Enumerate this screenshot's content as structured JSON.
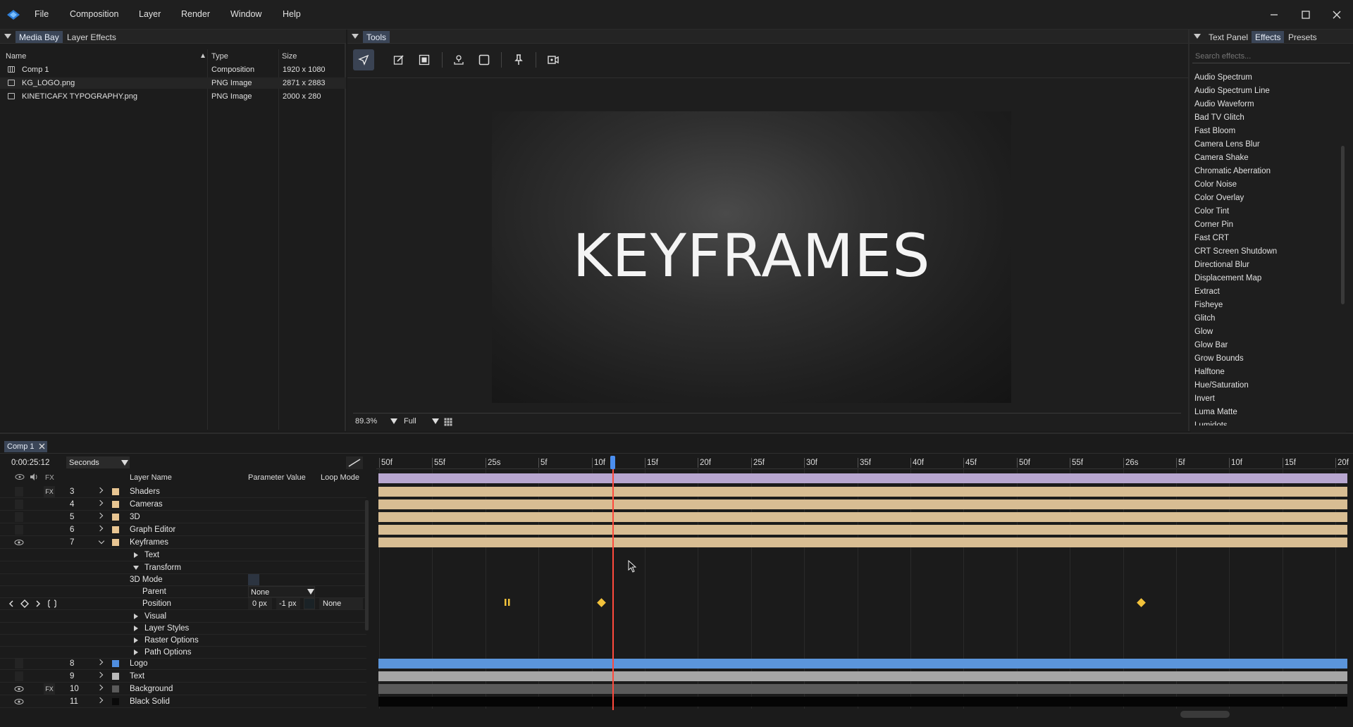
{
  "app": {
    "menu": [
      "File",
      "Composition",
      "Layer",
      "Render",
      "Window",
      "Help"
    ],
    "accent": "#3b6fd0",
    "window_controls": [
      "minimize-icon",
      "maximize-icon",
      "close-icon"
    ]
  },
  "media_bay": {
    "tabs": [
      "Media Bay",
      "Layer Effects"
    ],
    "columns": [
      "Name",
      "Type",
      "Size"
    ],
    "rows": [
      {
        "name": "Comp 1",
        "type": "Composition",
        "size": "1920 x 1080",
        "icon": "composition-icon"
      },
      {
        "name": "KG_LOGO.png",
        "type": "PNG Image",
        "size": "2871 x 2883",
        "icon": "image-icon"
      },
      {
        "name": "KINETICAFX TYPOGRAPHY.png",
        "type": "PNG Image",
        "size": "2000 x 280",
        "icon": "image-icon"
      }
    ]
  },
  "tools": {
    "tab": "Tools",
    "buttons": [
      "select-tool-icon",
      "edit-tool-icon",
      "mask-tool-icon",
      "anchor-tool-icon",
      "rectangle-tool-icon",
      "pin-tool-icon",
      "camera-tool-icon"
    ]
  },
  "viewer": {
    "canvas_text": "KEYFRAMES",
    "zoom": "89.3%",
    "quality": "Full"
  },
  "effects_panel": {
    "tabs": [
      "Text Panel",
      "Effects",
      "Presets"
    ],
    "search_placeholder": "Search effects...",
    "items": [
      "Audio Spectrum",
      "Audio Spectrum Line",
      "Audio Waveform",
      "Bad TV Glitch",
      "Fast Bloom",
      "Camera Lens Blur",
      "Camera Shake",
      "Chromatic Aberration",
      "Color Noise",
      "Color Overlay",
      "Color Tint",
      "Corner Pin",
      "Fast CRT",
      "CRT Screen Shutdown",
      "Directional Blur",
      "Displacement Map",
      "Extract",
      "Fisheye",
      "Glitch",
      "Glow",
      "Glow Bar",
      "Grow Bounds",
      "Halftone",
      "Hue/Saturation",
      "Invert",
      "Luma Matte",
      "Lumidots"
    ]
  },
  "timeline": {
    "comp_tab": "Comp 1",
    "timecode": "0:00:25:12",
    "time_unit": "Seconds",
    "fx_label": "FX",
    "columns": [
      "Layer Name",
      "Parameter Value",
      "Loop Mode"
    ],
    "ruler": [
      "50f",
      "55f",
      "25s",
      "5f",
      "10f",
      "15f",
      "20f",
      "25f",
      "30f",
      "35f",
      "40f",
      "45f",
      "50f",
      "55f",
      "26s",
      "5f",
      "10f",
      "15f",
      "20f"
    ],
    "layers_top": [
      {
        "num": "3",
        "name": "Shaders",
        "color": "#e8c592",
        "fx": "FX",
        "eye": false
      },
      {
        "num": "4",
        "name": "Cameras",
        "color": "#e8c592",
        "fx": "",
        "eye": false
      },
      {
        "num": "5",
        "name": "3D",
        "color": "#e8c592",
        "fx": "",
        "eye": false
      },
      {
        "num": "6",
        "name": "Graph Editor",
        "color": "#e8c592",
        "fx": "",
        "eye": false
      },
      {
        "num": "7",
        "name": "Keyframes",
        "color": "#e8c592",
        "fx": "",
        "eye": true
      }
    ],
    "props": {
      "text": "Text",
      "transform": "Transform",
      "mode3d": "3D Mode",
      "parent": "Parent",
      "parent_value": "None",
      "position": "Position",
      "pos_x": "0 px",
      "pos_y": "-1 px",
      "loop_mode": "None",
      "visual": "Visual",
      "layer_styles": "Layer Styles",
      "raster_options": "Raster Options",
      "path_options": "Path Options"
    },
    "layers_bottom": [
      {
        "num": "8",
        "name": "Logo",
        "color": "#4f8ee0",
        "fx": "",
        "eye": false
      },
      {
        "num": "9",
        "name": "Text",
        "color": "#b9b9b9",
        "fx": "",
        "eye": false
      },
      {
        "num": "10",
        "name": "Background",
        "color": "#5a5a5a",
        "fx": "FX",
        "eye": true
      },
      {
        "num": "11",
        "name": "Black Solid",
        "color": "#0a0a0a",
        "fx": "",
        "eye": true
      }
    ],
    "track_colors": {
      "purple": "#b7a6cf",
      "tan": "#d8bd93",
      "blue": "#5b95db",
      "gray": "#a6a6a6",
      "dark": "#5a5a5a",
      "black": "#050505"
    },
    "playhead_color": "#ff4a3d"
  }
}
